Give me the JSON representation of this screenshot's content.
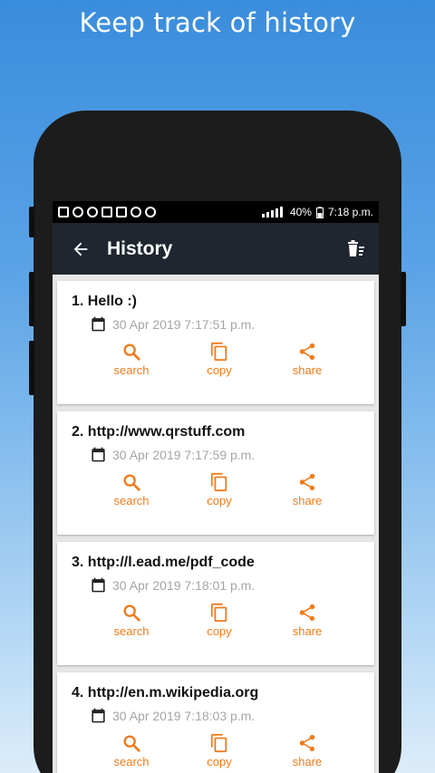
{
  "banner": {
    "title": "Keep track of history"
  },
  "statusbar": {
    "battery": "40%",
    "time": "7:18 p.m."
  },
  "appbar": {
    "title": "History"
  },
  "actions": {
    "search": "search",
    "copy": "copy",
    "share": "share"
  },
  "history": [
    {
      "title": "1. Hello :)",
      "date": "30 Apr 2019 7:17:51 p.m."
    },
    {
      "title": "2. http://www.qrstuff.com",
      "date": "30 Apr 2019 7:17:59 p.m."
    },
    {
      "title": "3. http://l.ead.me/pdf_code",
      "date": "30 Apr 2019 7:18:01 p.m."
    },
    {
      "title": "4. http://en.m.wikipedia.org",
      "date": "30 Apr 2019 7:18:03 p.m."
    }
  ],
  "colors": {
    "accent": "#f07c1d",
    "appbar": "#1f2630",
    "date": "#a5a5a5"
  }
}
